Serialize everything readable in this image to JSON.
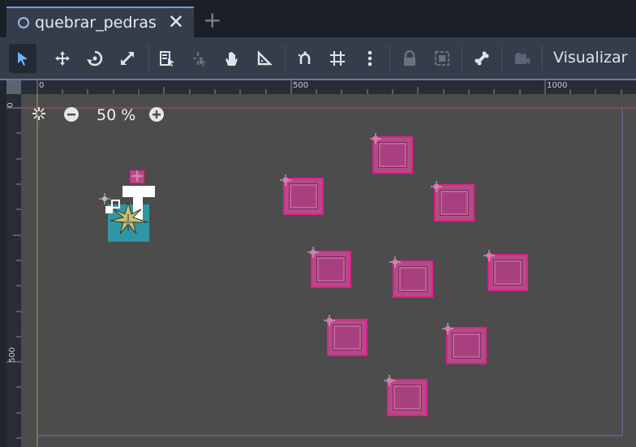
{
  "tab": {
    "title": "quebrar_pedras",
    "close": "✕",
    "add": "+"
  },
  "toolbar": {
    "view_menu": "Visualizar"
  },
  "ruler": {
    "h_labels": [
      "0",
      "500",
      "1000"
    ],
    "v_labels": [
      "0",
      "500"
    ]
  },
  "zoom": {
    "level": "50 %",
    "minus": "−",
    "plus": "+"
  },
  "colors": {
    "accent": "#6f9ce3",
    "canvas": "#4c4c4c",
    "rock_fill": "#b24c86",
    "rock_border": "#e0208c",
    "player": "#2aa3b4"
  },
  "scene": {
    "rock_count": 10,
    "player_node": "player"
  }
}
